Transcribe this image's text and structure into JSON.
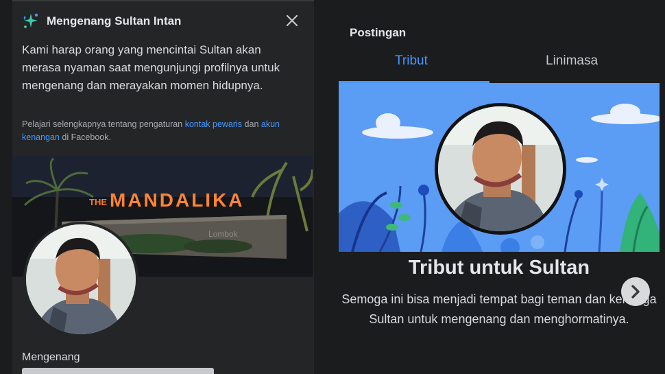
{
  "left_panel": {
    "title": "Mengenang Sultan Intan",
    "intro": "Kami harap orang yang mencintai Sultan akan merasa nyaman saat mengunjungi profilnya untuk mengenang dan merayakan momen hidupnya.",
    "learn_prefix": "Pelajari selengkapnya tentang pengaturan ",
    "learn_link_1": "kontak pewaris",
    "learn_middle": " dan ",
    "learn_link_2": "akun kenangan",
    "learn_suffix": " di Facebook.",
    "cover_sign_text": "THE MANDALIKA",
    "cover_sign_sub": "Lombok",
    "memorial_label": "Mengenang"
  },
  "right_panel": {
    "section_title": "Postingan",
    "tabs": [
      {
        "label": "Tribut",
        "active": true
      },
      {
        "label": "Linimasa",
        "active": false
      }
    ],
    "tribute_title": "Tribut untuk Sultan",
    "tribute_desc": "Semoga ini bisa menjadi tempat bagi teman dan keluarga Sultan untuk mengenang dan menghormatinya."
  },
  "icons": {
    "title_icon": "sparkle-icon",
    "close": "close-icon",
    "next": "chevron-right-icon"
  },
  "colors": {
    "accent": "#4599ff",
    "panel_bg": "#242526",
    "page_bg": "#1b1c1e",
    "banner_bg": "#5b9cf4"
  }
}
